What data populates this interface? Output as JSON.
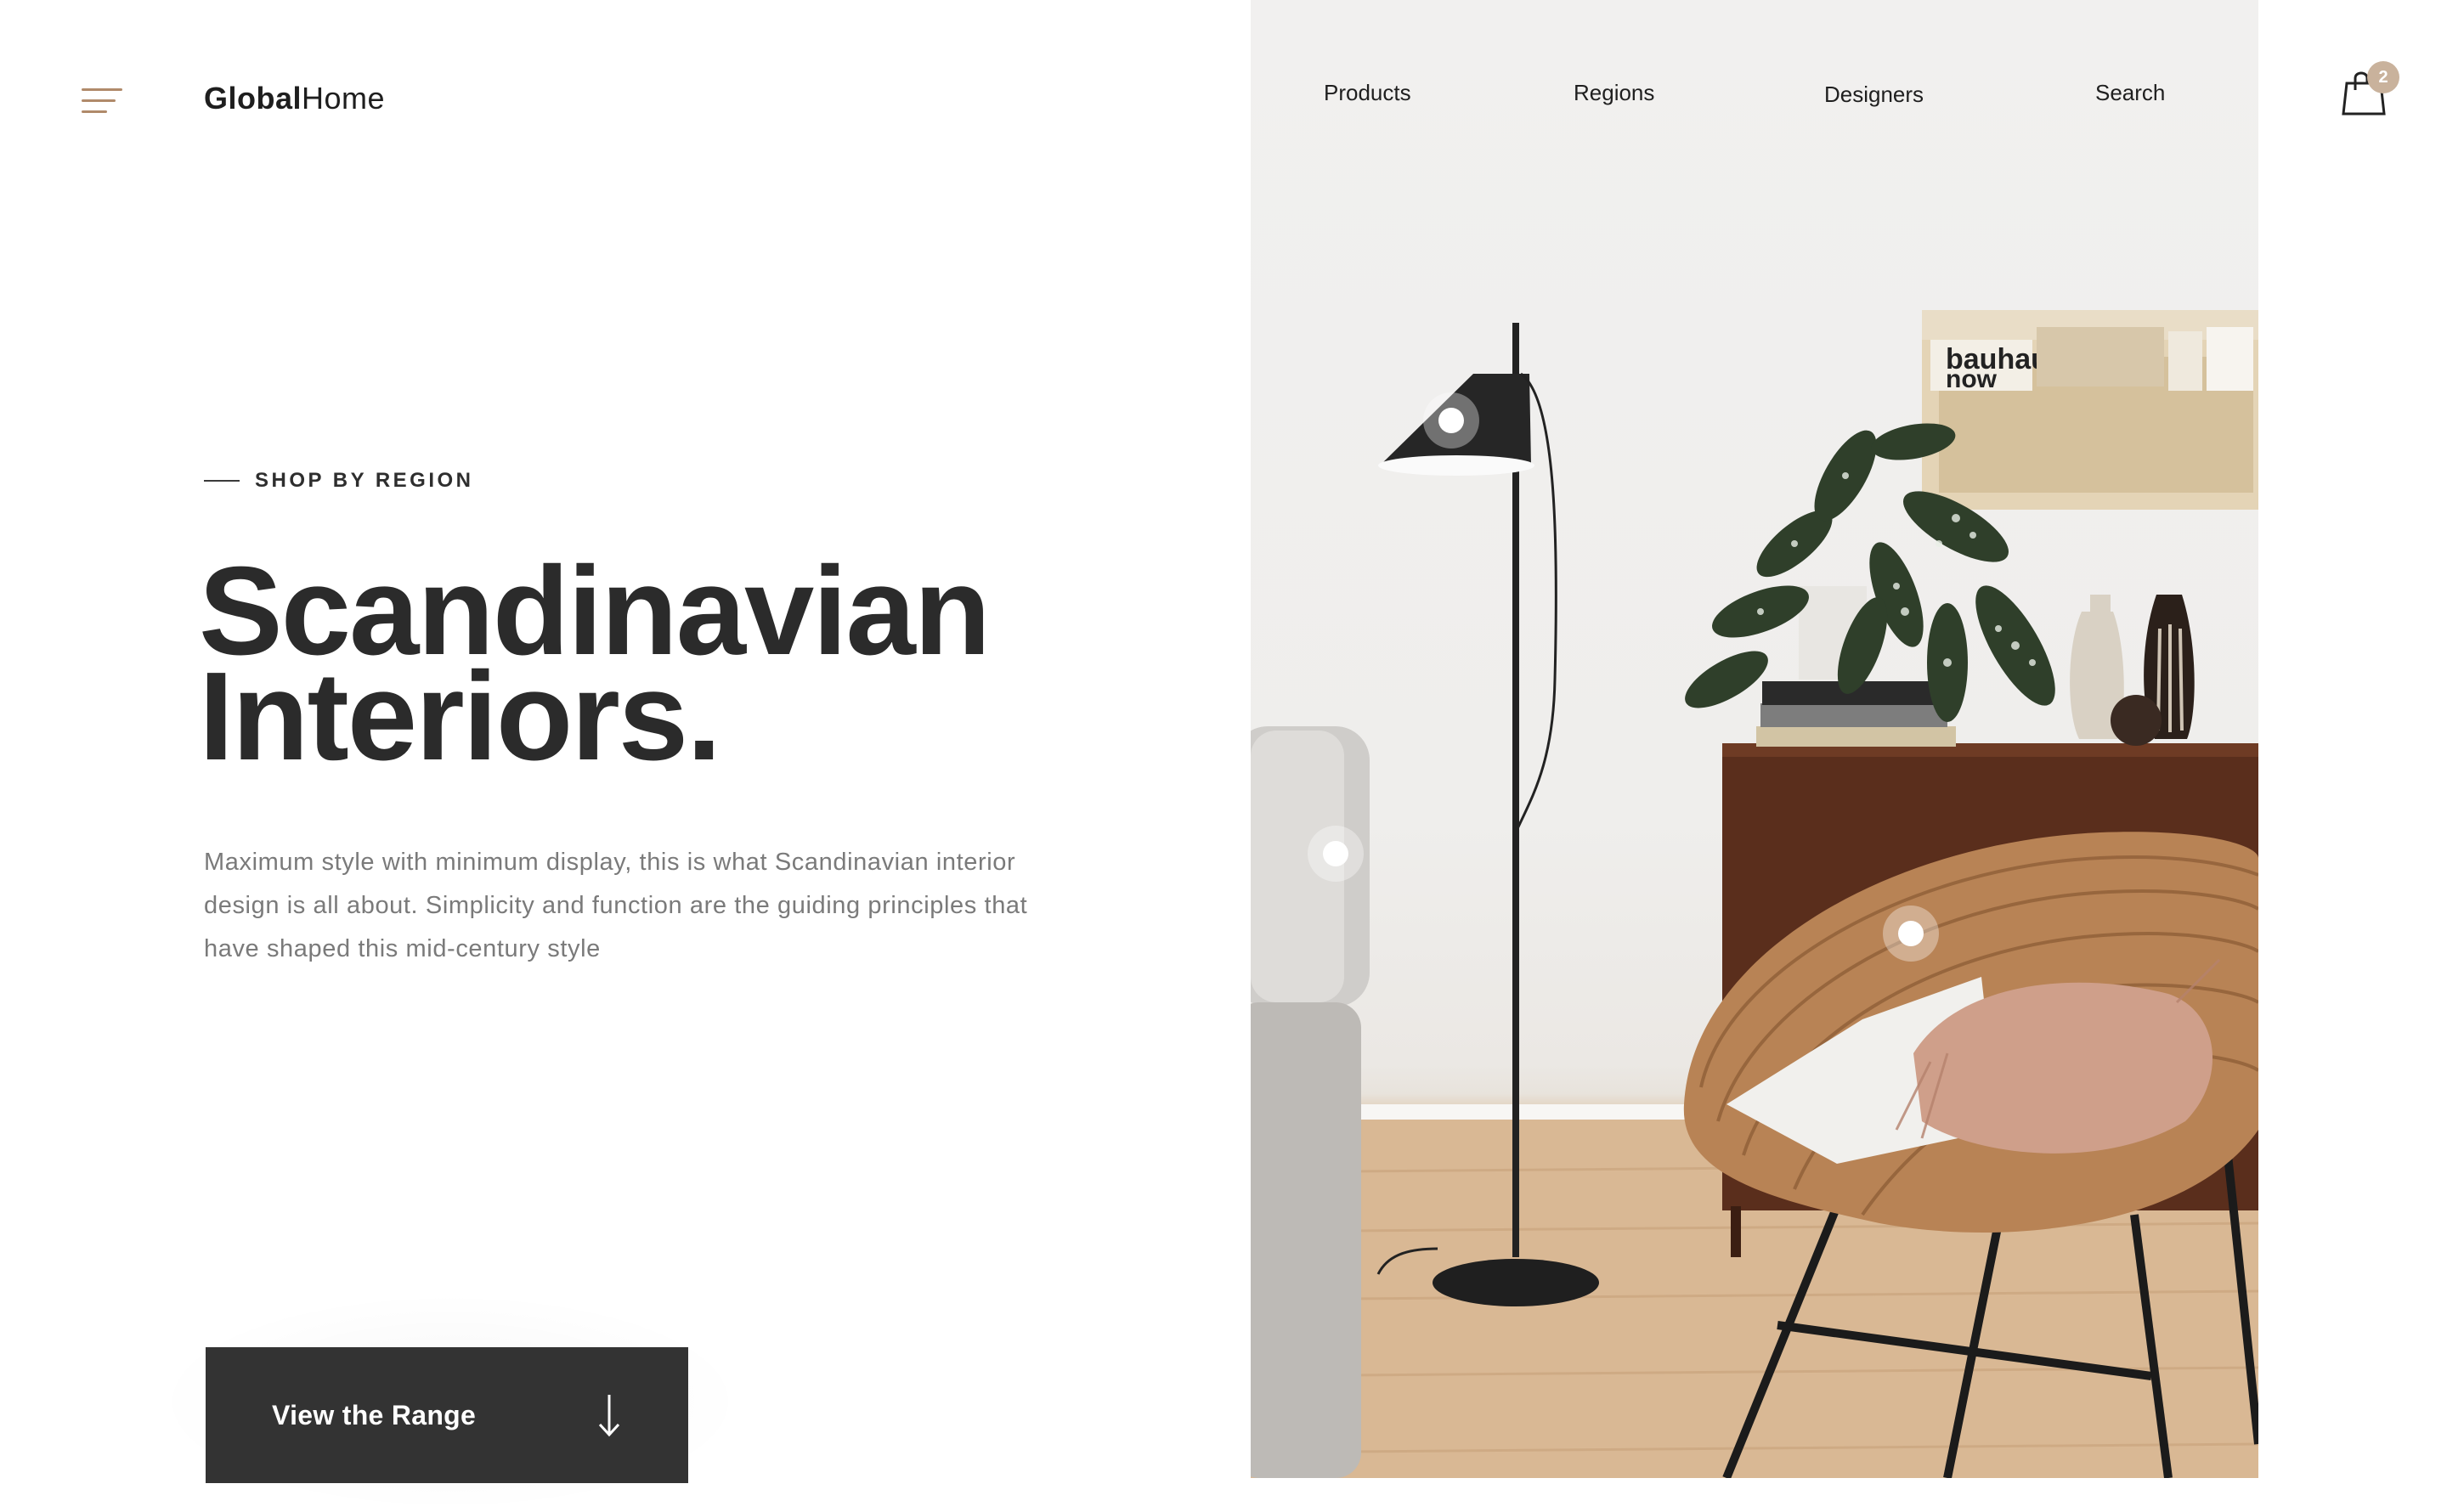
{
  "brand": {
    "bold": "Global",
    "light": "Home"
  },
  "nav": {
    "products": "Products",
    "regions": "Regions",
    "designers": "Designers",
    "search": "Search"
  },
  "cart": {
    "count": "2",
    "icon": "shopping-bag-icon"
  },
  "menu": {
    "icon": "hamburger-menu-icon"
  },
  "hero": {
    "eyebrow": "SHOP BY REGION",
    "title_line1": "Scandinavian",
    "title_line2": "Interiors.",
    "intro": "Maximum style with minimum display, this is what Scandinavian interior design is all about. Simplicity and function are the guiding principles that have shaped this mid-century style",
    "cta_label": "View the Range",
    "cta_icon": "arrow-down-icon"
  },
  "image": {
    "book_text": "bauhaus now"
  },
  "colors": {
    "accent": "#b08a6a",
    "text_dark": "#2b2b2b",
    "text_muted": "#7a7a7a",
    "button_bg": "#333333",
    "badge_bg": "#c9b29c"
  }
}
